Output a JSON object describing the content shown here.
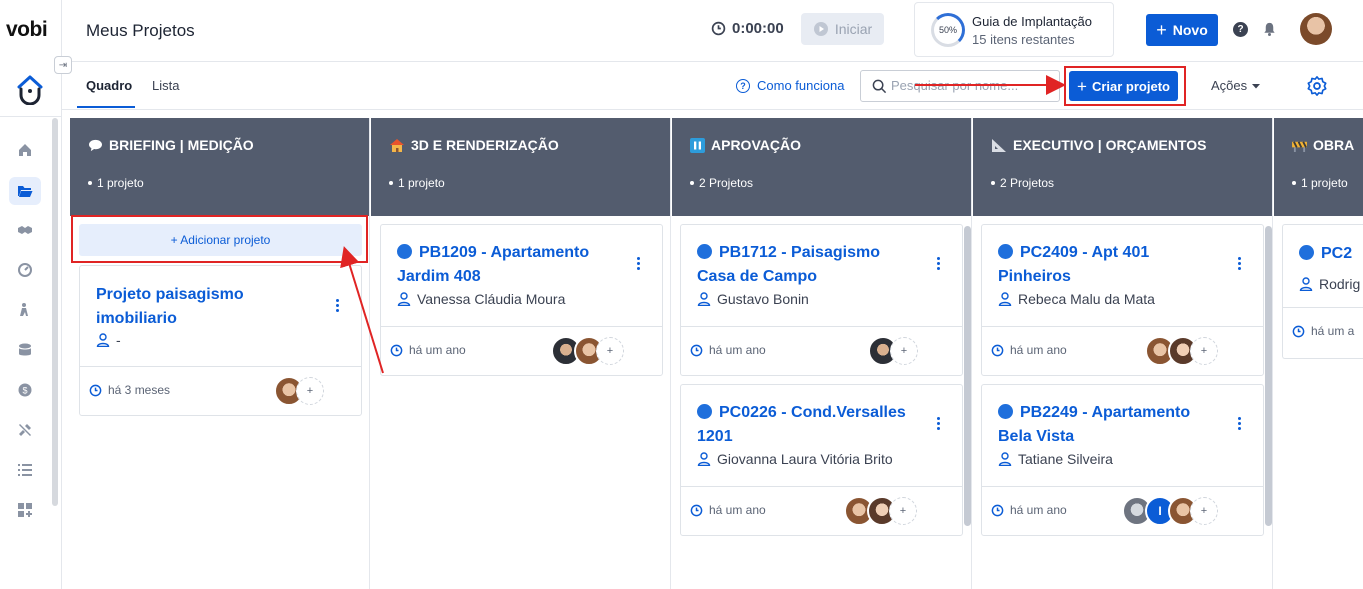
{
  "app": {
    "logo": "vobi",
    "page_title": "Meus Projetos"
  },
  "header": {
    "timer": "0:00:00",
    "start_label": "Iniciar",
    "guide": {
      "percent": "50%",
      "title": "Guia de Implantação",
      "subtitle": "15 itens restantes",
      "progress": 0.5
    },
    "new_label": "Novo",
    "help": "?"
  },
  "subbar": {
    "tabs": [
      {
        "label": "Quadro",
        "active": true
      },
      {
        "label": "Lista",
        "active": false
      }
    ],
    "how_it_works": "Como funciona",
    "search_placeholder": "Pesquisar por nome...",
    "create_label": "Criar projeto",
    "actions_label": "Ações"
  },
  "colors": {
    "primary": "#0b5cd6",
    "column_header": "#535c6e",
    "highlight": "#e02424"
  },
  "board": {
    "add_project_label": "+ Adicionar projeto",
    "columns": [
      {
        "icon": "speech-bubble-icon",
        "title": "BRIEFING | MEDIÇÃO",
        "count": "1 projeto",
        "cards": [
          {
            "title": "Projeto paisagismo imobiliario",
            "owner": "-",
            "time": "há 3 meses",
            "dot": false
          }
        ]
      },
      {
        "icon": "house-icon",
        "title": "3D E RENDERIZAÇÃO",
        "count": "1 projeto",
        "cards": [
          {
            "title": "PB1209 - Apartamento Jardim 408",
            "owner": "Vanessa Cláudia Moura",
            "time": "há um ano",
            "dot": true
          }
        ]
      },
      {
        "icon": "pause-icon",
        "title": "APROVAÇÃO",
        "count": "2 Projetos",
        "cards": [
          {
            "title": "PB1712 - Paisagismo Casa de Campo",
            "owner": "Gustavo Bonin",
            "time": "há um ano",
            "dot": true
          },
          {
            "title": "PC0226 - Cond.Versalles 1201",
            "owner": "Giovanna Laura Vitória Brito",
            "time": "há um ano",
            "dot": true
          }
        ]
      },
      {
        "icon": "triangle-ruler-icon",
        "title": "EXECUTIVO | ORÇAMENTOS",
        "count": "2 Projetos",
        "cards": [
          {
            "title": "PC2409 - Apt 401 Pinheiros",
            "owner": "Rebeca Malu da Mata",
            "time": "há um ano",
            "dot": true
          },
          {
            "title": "PB2249 - Apartamento Bela Vista",
            "owner": "Tatiane Silveira",
            "time": "há um ano",
            "dot": true
          }
        ]
      },
      {
        "icon": "construction-icon",
        "title": "OBRA",
        "count": "1 projeto",
        "cards": [
          {
            "title": "PC2",
            "owner": "Rodrig",
            "time": "há um a",
            "dot": true
          }
        ]
      }
    ],
    "avatar_plus": "+",
    "avatar_initial": "I"
  }
}
